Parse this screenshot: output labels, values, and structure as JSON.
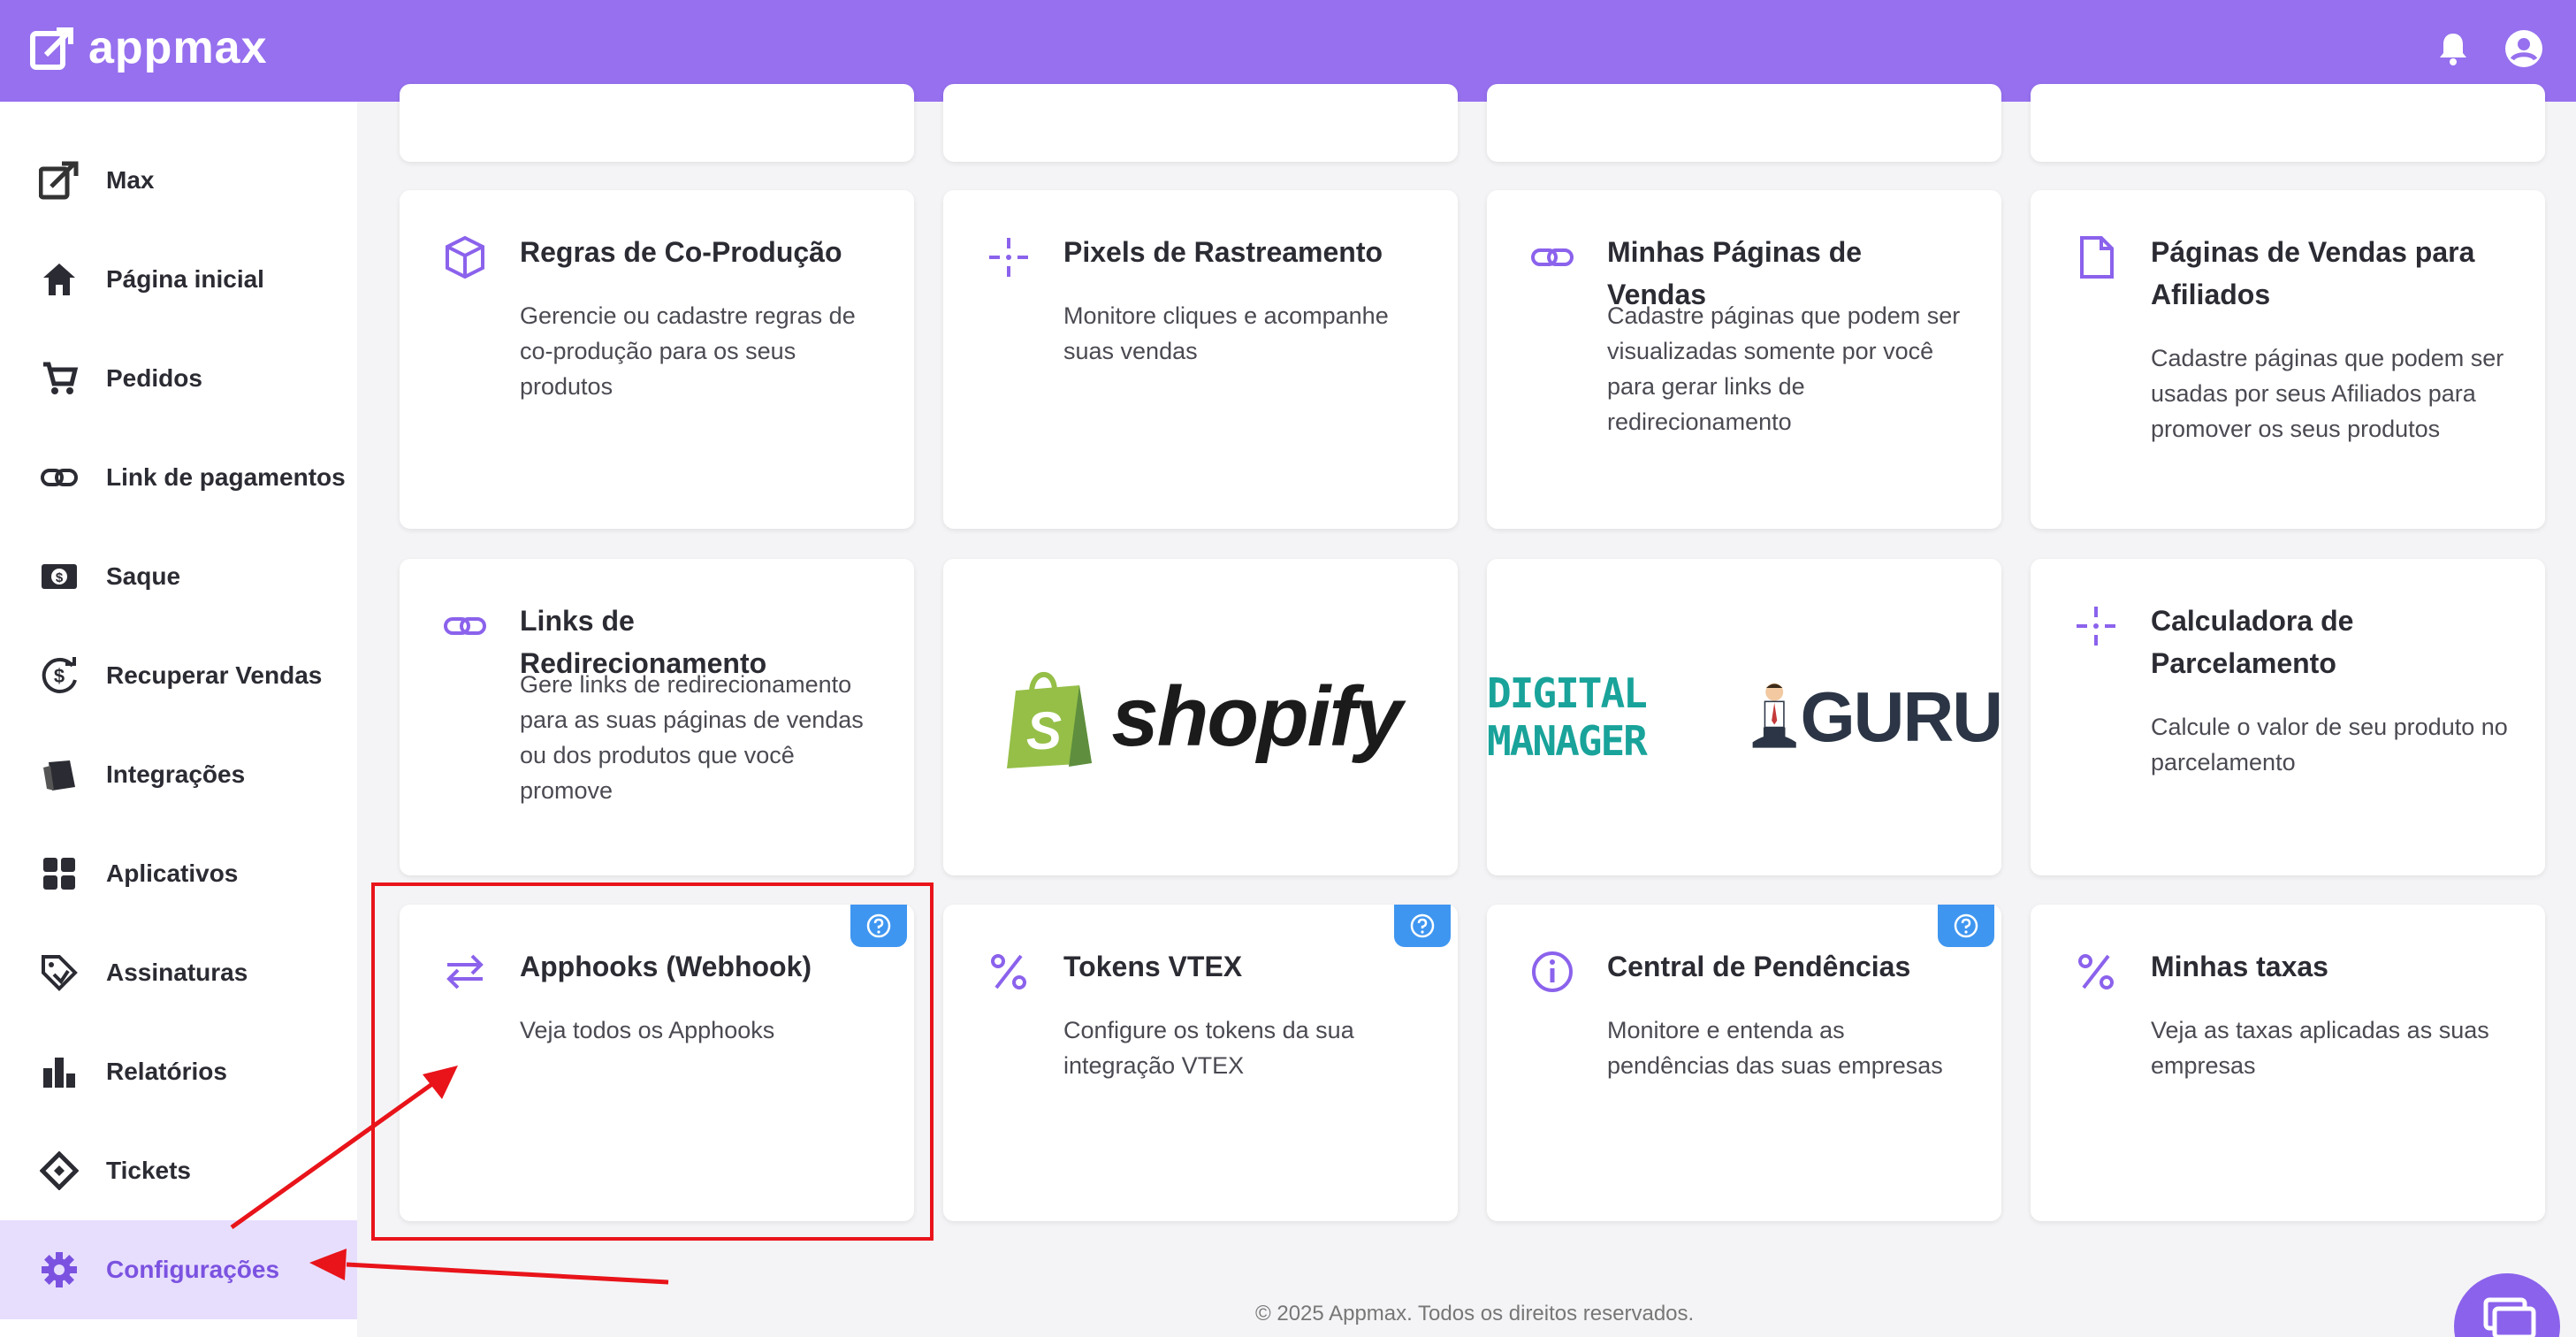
{
  "header": {
    "brand": "appmax"
  },
  "sidebar": {
    "items": [
      {
        "label": "Max",
        "icon": "max-logo-icon"
      },
      {
        "label": "Página inicial",
        "icon": "home-icon"
      },
      {
        "label": "Pedidos",
        "icon": "cart-icon"
      },
      {
        "label": "Link de pagamentos",
        "icon": "link-icon"
      },
      {
        "label": "Saque",
        "icon": "money-icon"
      },
      {
        "label": "Recuperar Vendas",
        "icon": "recover-dollar-icon"
      },
      {
        "label": "Integrações",
        "icon": "integrations-icon"
      },
      {
        "label": "Aplicativos",
        "icon": "apps-grid-icon"
      },
      {
        "label": "Assinaturas",
        "icon": "tag-icon"
      },
      {
        "label": "Relatórios",
        "icon": "bar-chart-icon"
      },
      {
        "label": "Tickets",
        "icon": "ticket-icon"
      },
      {
        "label": "Configurações",
        "icon": "gear-icon",
        "active": true
      }
    ]
  },
  "cards": {
    "coproducao": {
      "title": "Regras de Co-Produção",
      "desc": "Gerencie ou cadastre regras de co-produção para os seus produtos"
    },
    "pixels": {
      "title": "Pixels de Rastreamento",
      "desc": "Monitore cliques e acompanhe suas vendas"
    },
    "paginas": {
      "title": "Minhas Páginas de Vendas",
      "desc": "Cadastre páginas que podem ser visualizadas somente por você para gerar links de redirecionamento"
    },
    "afiliados": {
      "title": "Páginas de Vendas para Afiliados",
      "desc": "Cadastre páginas que podem ser usadas por seus Afiliados para promover os seus produtos"
    },
    "links": {
      "title": "Links de Redirecionamento",
      "desc": "Gere links de redirecionamento para as suas páginas de vendas ou dos produtos que você promove"
    },
    "shopify": {
      "brand": "shopify",
      "letter": "S"
    },
    "guru": {
      "brand_a": "DIGITAL MANAGER",
      "brand_b": "GURU"
    },
    "calculadora": {
      "title": "Calculadora de Parcelamento",
      "desc": "Calcule o valor de seu produto no parcelamento"
    },
    "apphooks": {
      "title": "Apphooks (Webhook)",
      "desc": "Veja todos os Apphooks"
    },
    "vtex": {
      "title": "Tokens VTEX",
      "desc": "Configure os tokens da sua integração VTEX"
    },
    "pendencias": {
      "title": "Central de Pendências",
      "desc": "Monitore e entenda as pendências das suas empresas"
    },
    "taxas": {
      "title": "Minhas taxas",
      "desc": "Veja as taxas aplicadas as suas empresas"
    }
  },
  "footer": {
    "text": "© 2025 Appmax. Todos os direitos reservados."
  },
  "colors": {
    "brand": "#9670ee",
    "accent": "#7b52e0",
    "help": "#3f96f0",
    "annotation": "#e8141a"
  }
}
